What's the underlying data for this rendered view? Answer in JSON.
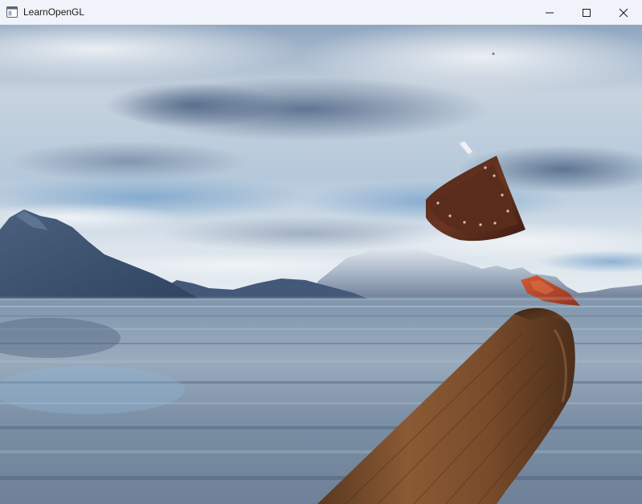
{
  "window": {
    "title": "LearnOpenGL",
    "icon": "app-window-icon",
    "controls": {
      "minimize_icon": "minimize-icon",
      "maximize_icon": "maximize-icon",
      "close_icon": "close-icon"
    }
  },
  "scene": {
    "sky_top": "#5d7ca6",
    "sky_mid": "#b9c9d9",
    "horizon_haze": "#dfe6ee",
    "water_color": "#7f93a8",
    "mountain_color": "#3e5676",
    "wood_color": "#7a4c2b",
    "leather_color": "#5e2d1c",
    "rust_color": "#b8482b"
  }
}
